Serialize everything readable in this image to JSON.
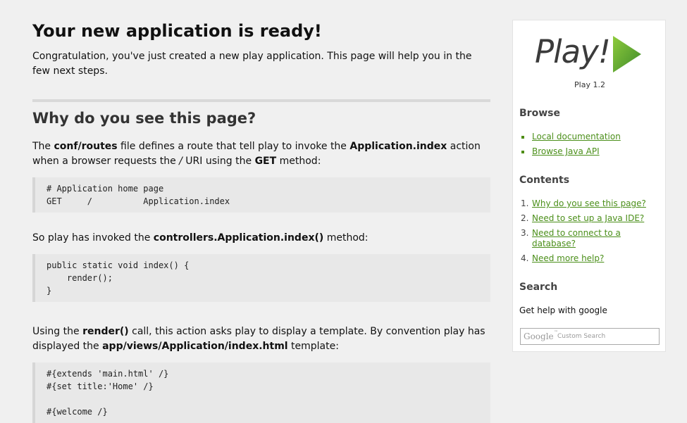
{
  "main": {
    "title": "Your new application is ready!",
    "intro": "Congratulation, you've just created a new play application. This page will help you in the few next steps.",
    "section_title": "Why do you see this page?",
    "p1": {
      "t1": "The ",
      "b1": "conf/routes",
      "t2": " file defines a route that tell play to invoke the ",
      "b2": "Application.index",
      "t3": " action when a browser requests the ",
      "i1": "/",
      "t4": " URI using the ",
      "b3": "GET",
      "t5": " method:"
    },
    "code1": "# Application home page\nGET     /          Application.index",
    "p2": {
      "t1": "So play has invoked the ",
      "b1": "controllers.Application.index()",
      "t2": " method:"
    },
    "code2": "public static void index() {\n    render();\n}",
    "p3": {
      "t1": "Using the ",
      "b1": "render()",
      "t2": " call, this action asks play to display a template. By convention play has displayed the ",
      "b2": "app/views/Application/index.html",
      "t3": " template:"
    },
    "code3": "#{extends 'main.html' /}\n#{set title:'Home' /}\n\n#{welcome /}"
  },
  "sidebar": {
    "logo_text": "Play!",
    "version": "Play 1.2",
    "browse_heading": "Browse",
    "browse_links": [
      {
        "label": "Local documentation"
      },
      {
        "label": "Browse Java API"
      }
    ],
    "contents_heading": "Contents",
    "contents_links": [
      {
        "num": "1.",
        "label": "Why do you see this page?"
      },
      {
        "num": "2.",
        "label": "Need to set up a Java IDE?"
      },
      {
        "num": "3.",
        "label": "Need to connect to a database?"
      },
      {
        "num": "4.",
        "label": "Need more help?"
      }
    ],
    "search_heading": "Search",
    "search_help": "Get help with google",
    "search_placeholder": {
      "brand": "Google",
      "tm": "™",
      "text": "Custom Search"
    }
  },
  "colors": {
    "link": "#4b8f1a",
    "logo_green": "#4e9a2a"
  }
}
